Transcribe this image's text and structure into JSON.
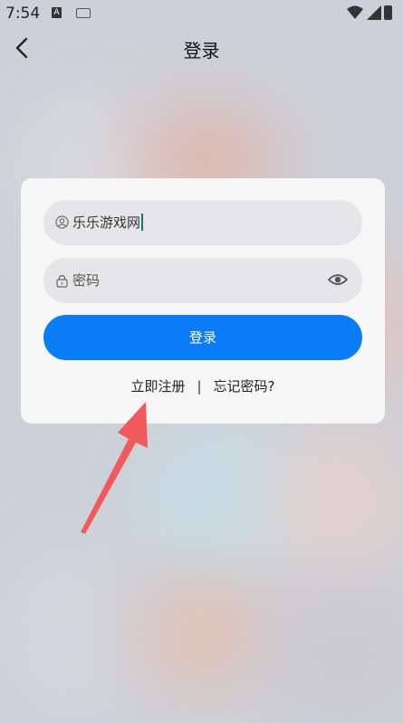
{
  "status_bar": {
    "time": "7:54",
    "a_badge": "A"
  },
  "header": {
    "title": "登录"
  },
  "form": {
    "username_value": "乐乐游戏网",
    "password_placeholder": "密码",
    "login_button": "登录"
  },
  "links": {
    "register": "立即注册",
    "separator": "|",
    "forgot": "忘记密码?"
  },
  "colors": {
    "primary_button": "#0a7cf8",
    "annotation_arrow": "#f05a5a"
  },
  "icons": [
    "back-arrow-icon",
    "user-icon",
    "lock-icon",
    "eye-icon",
    "wifi-icon",
    "signal-icon",
    "battery-icon",
    "keyboard-icon"
  ]
}
